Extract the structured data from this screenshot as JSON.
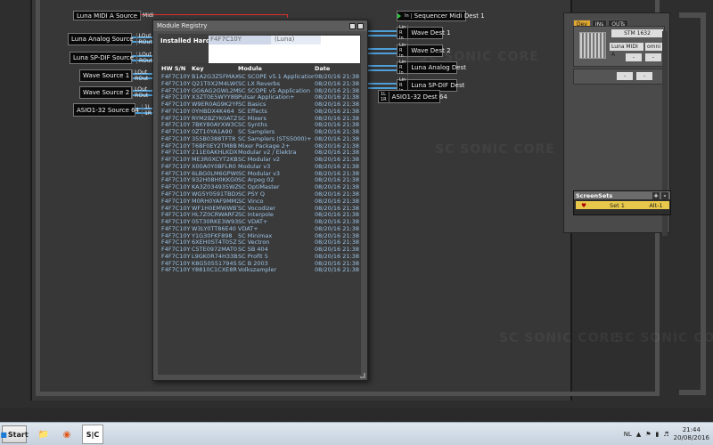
{
  "watermark": "SC SONIC CORE",
  "sources": [
    {
      "label": "Luna MIDI A Source",
      "ports": [
        "Midi"
      ]
    },
    {
      "label": "Luna Analog Source",
      "ports": [
        "LOut",
        "ROut"
      ]
    },
    {
      "label": "Luna SP-DIF Source",
      "ports": [
        "LOut",
        "ROut"
      ]
    },
    {
      "label": "Wave Source 1",
      "ports": [
        "LOut",
        "ROut"
      ]
    },
    {
      "label": "Wave Source 2",
      "ports": [
        "LOut",
        "ROut"
      ]
    },
    {
      "label": "ASIO1-32 Source 64",
      "ports": [
        "1L",
        "1R"
      ]
    }
  ],
  "dests": [
    {
      "label": "Sequencer Midi Dest 1",
      "ports": [
        "In"
      ]
    },
    {
      "label": "Wave Dest 1",
      "ports": [
        "Lin",
        "R In"
      ]
    },
    {
      "label": "Wave Dest 2",
      "ports": [
        "Lin",
        "R In"
      ]
    },
    {
      "label": "Luna Analog Dest",
      "ports": [
        "Lin",
        "R In"
      ]
    },
    {
      "label": "Luna SP-DIF Dest",
      "ports": [
        "Lin",
        "R In"
      ]
    },
    {
      "label": "ASIO1-32 Dest 64",
      "ports": [
        "1L",
        "1R"
      ]
    }
  ],
  "module_registry": {
    "title": "Module Registry",
    "installed_label": "Installed Hardware",
    "hardware_sn": "F4F7C10Y",
    "hardware_name": "(Luna)",
    "columns": [
      "HW S/N",
      "Key",
      "Module",
      "Date"
    ],
    "rows": [
      [
        "F4F7C10Y",
        "B1A2G3Z5FMAX",
        "SC SCOPE v5.1 Application",
        "08/20/16 21:38"
      ],
      [
        "F4F7C10Y",
        "Q21T0X2M4LW0",
        "SC LX Reverbs",
        "08/20/16 21:38"
      ],
      [
        "F4F7C10Y",
        "GG6AG2GWL2M2",
        "SC SCOPE v5 Application",
        "08/20/16 21:38"
      ],
      [
        "F4F7C10Y",
        "X3ZT0E5WYY8B",
        "Pulsar Application+",
        "08/20/16 21:38"
      ],
      [
        "F4F7C10Y",
        "W9ER0AG9K2YR",
        "SC Basics",
        "08/20/16 21:38"
      ],
      [
        "F4F7C10Y",
        "0YHBDX4K464",
        "SC Effects",
        "08/20/16 21:38"
      ],
      [
        "F4F7C10Y",
        "RYM2BZYK0ATZ",
        "SC Mixers",
        "08/20/16 21:38"
      ],
      [
        "F4F7C10Y",
        "7BKY80AYXW3C",
        "SC Synths",
        "08/20/16 21:38"
      ],
      [
        "F4F7C10Y",
        "0ZT10YA1A90",
        "SC Samplers",
        "08/20/16 21:38"
      ],
      [
        "F4F7C10Y",
        "355B0388TFT8",
        "SC Samplers (STS5000)+",
        "08/20/16 21:38"
      ],
      [
        "F4F7C10Y",
        "T6BF0EY2TM8B",
        "Mixer Package 2+",
        "08/20/16 21:38"
      ],
      [
        "F4F7C10Y",
        "211E0AKHLKDX",
        "Modular v2 / Elektra",
        "08/20/16 21:38"
      ],
      [
        "F4F7C10Y",
        "ME3R0XCYT2KB",
        "SC Modular v2",
        "08/20/16 21:38"
      ],
      [
        "F4F7C10Y",
        "X00A0Y0BFLR0",
        "Modular v3",
        "08/20/16 21:38"
      ],
      [
        "F4F7C10Y",
        "6LBG0LM6GPWC",
        "SC Modular v3",
        "08/20/16 21:38"
      ],
      [
        "F4F7C10Y",
        "932H08H0KKG0",
        "SC Arpeg 02",
        "08/20/16 21:38"
      ],
      [
        "F4F7C10Y",
        "KA3Z034935WZ",
        "SC OptiMaster",
        "08/20/16 21:38"
      ],
      [
        "F4F7C10Y",
        "WG5Y0591TBDX",
        "SC PSY Q",
        "08/20/16 21:38"
      ],
      [
        "F4F7C10Y",
        "M0RH0YAF9MM2",
        "SC Vinco",
        "08/20/16 21:38"
      ],
      [
        "F4F7C10Y",
        "WF1H0EMWWBT",
        "SC Vocodizer",
        "08/20/16 21:38"
      ],
      [
        "F4F7C10Y",
        "HL7Z0CRWARFZ",
        "SC Interpole",
        "08/20/16 21:38"
      ],
      [
        "F4F7C10Y",
        "05T30RKE3W93",
        "SC VDAT+",
        "08/20/16 21:38"
      ],
      [
        "F4F7C10Y",
        "W3LY0TT86E40",
        "VDAT+",
        "08/20/16 21:38"
      ],
      [
        "F4F7C10Y",
        "Y1G30FKF898",
        "SC Minimax",
        "08/20/16 21:38"
      ],
      [
        "F4F7C10Y",
        "6XEH0ST4T05Z",
        "SC Vectron",
        "08/20/16 21:38"
      ],
      [
        "F4F7C10Y",
        "C5TE0972MAT0",
        "SC SB 404",
        "08/20/16 21:38"
      ],
      [
        "F4F7C10Y",
        "L9GK0R74H33B",
        "SC Profit 5",
        "08/20/16 21:38"
      ],
      [
        "F4F7C10Y",
        "K8G50551794S",
        "SC B 2003",
        "08/20/16 21:38"
      ],
      [
        "F4F7C10Y",
        "Y8810C1CXE8R",
        "Volkszampler",
        "08/20/16 21:38"
      ]
    ]
  },
  "right_panel": {
    "tabs": [
      "Dev",
      "INs",
      "OUTs"
    ],
    "device_name": "STM 1632",
    "midi_label": "Luna MIDI A",
    "midi_channel": "omni",
    "dash1": "-",
    "dash2": "-",
    "dash3": "-",
    "dash4": "-"
  },
  "screensets": {
    "title": "ScreenSets",
    "add": "+",
    "remove": "-",
    "item_name": "Set 1",
    "item_key": "Alt-1"
  },
  "taskbar": {
    "start": "Start",
    "lang": "NL",
    "time": "21:44",
    "date": "20/08/2016",
    "scope_icon": "S|C"
  }
}
